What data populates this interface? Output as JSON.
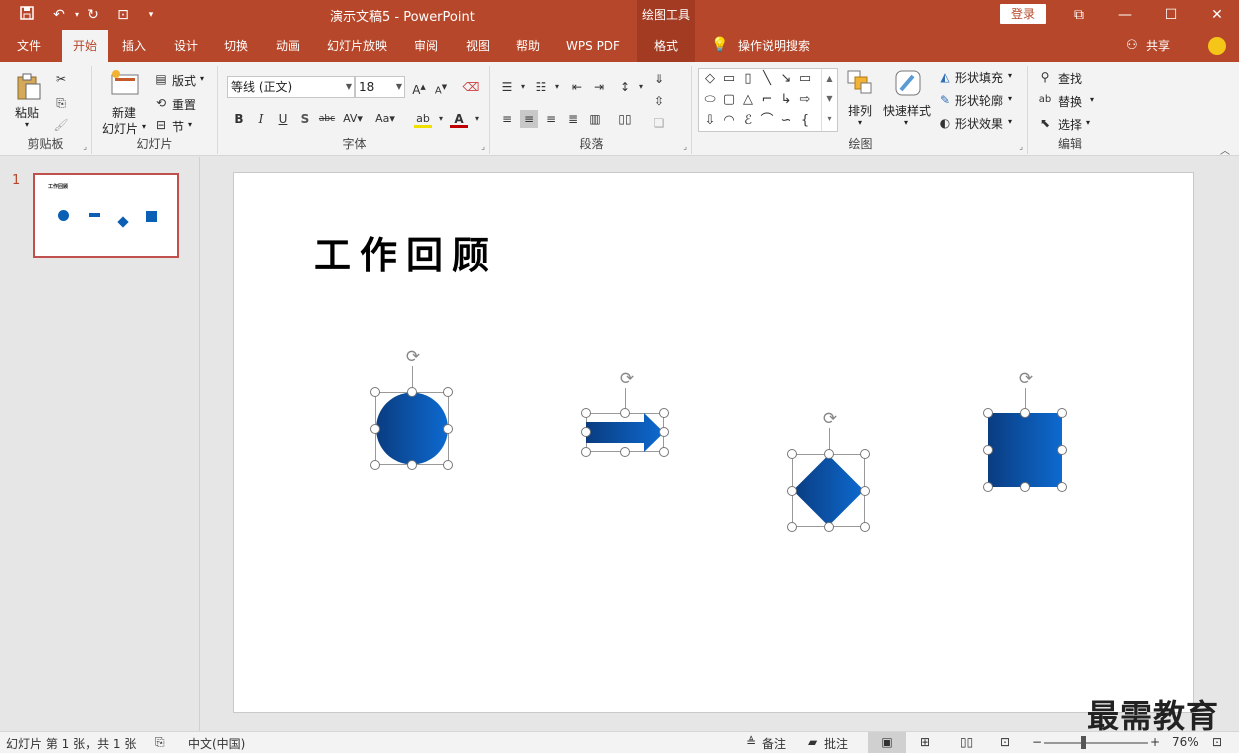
{
  "window": {
    "doc_title": "演示文稿5  -  PowerPoint",
    "context_tools": "绘图工具",
    "login_label": "登录"
  },
  "quick_access": [
    "save-icon",
    "undo-icon",
    "redo-icon",
    "present-icon",
    "customize-icon"
  ],
  "menu": {
    "tabs": [
      "文件",
      "开始",
      "插入",
      "设计",
      "切换",
      "动画",
      "幻灯片放映",
      "审阅",
      "视图",
      "帮助",
      "WPS PDF",
      "格式"
    ],
    "active": "开始",
    "search_label": "操作说明搜索",
    "share_label": "共享"
  },
  "ribbon": {
    "clipboard": {
      "label": "剪贴板",
      "paste": "粘贴"
    },
    "slides": {
      "label": "幻灯片",
      "new_slide_1": "新建",
      "new_slide_2": "幻灯片",
      "layout": "版式",
      "reset": "重置",
      "section": "节"
    },
    "font": {
      "label": "字体",
      "font_name": "等线 (正文)",
      "font_size": "18"
    },
    "paragraph": {
      "label": "段落"
    },
    "drawing": {
      "label": "绘图",
      "arrange": "排列",
      "quick_styles": "快速样式",
      "shape_fill": "形状填充",
      "shape_outline": "形状轮廓",
      "shape_effects": "形状效果"
    },
    "editing": {
      "label": "编辑",
      "find": "查找",
      "replace": "替换",
      "select": "选择"
    }
  },
  "thumbnails": {
    "slide_number": "1",
    "thumb_title": "工作回顾"
  },
  "slide": {
    "title": "工作回顾"
  },
  "watermark": "最需教育",
  "status": {
    "slide_info": "幻灯片 第 1 张，共 1 张",
    "language": "中文(中国)",
    "notes": "备注",
    "comments": "批注",
    "zoom": "76%"
  },
  "colors": {
    "accent": "#b7472a",
    "shape_blue": "#0b5fb4",
    "shape_dark": "#0a3c80"
  }
}
